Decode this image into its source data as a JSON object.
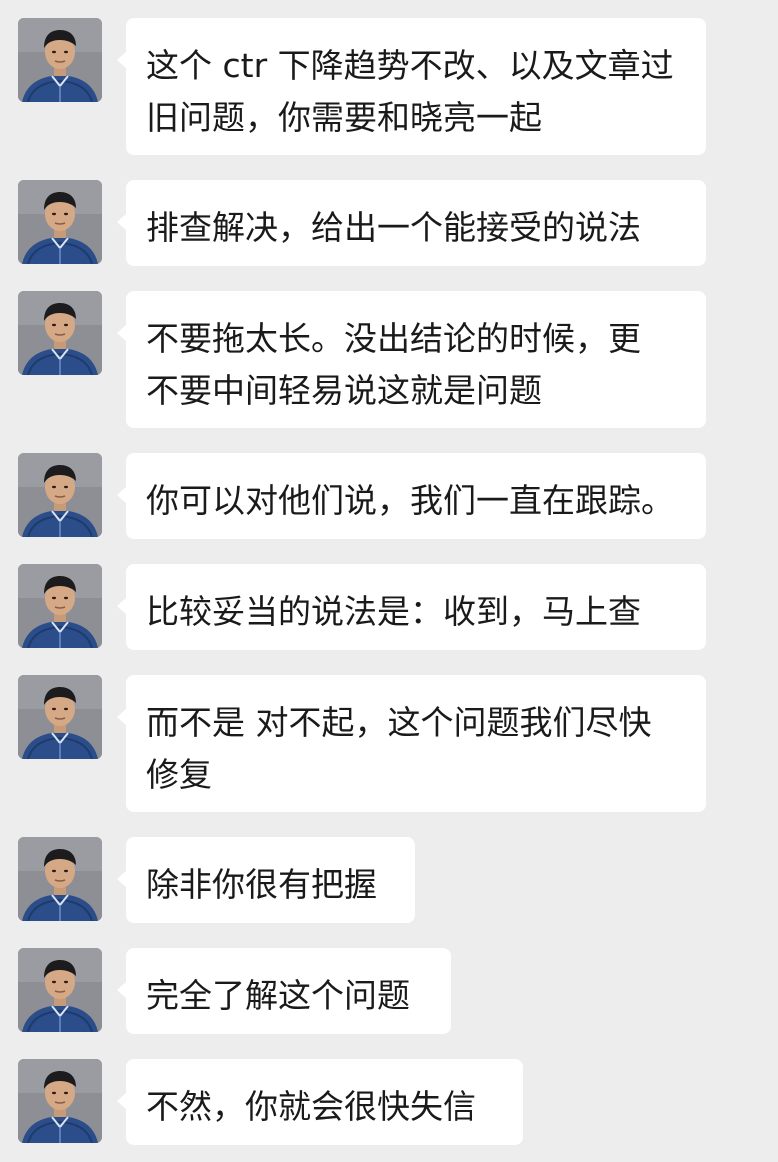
{
  "conversation": {
    "messages": [
      {
        "sender_avatar": "avatar-man-blue-sweater",
        "text": "这个 ctr 下降趋势不改、以及文章过\n旧问题，你需要和晓亮一起"
      },
      {
        "sender_avatar": "avatar-man-blue-sweater",
        "text": "排查解决，给出一个能接受的说法"
      },
      {
        "sender_avatar": "avatar-man-blue-sweater",
        "text": "不要拖太长。没出结论的时候，更\n不要中间轻易说这就是问题"
      },
      {
        "sender_avatar": "avatar-man-blue-sweater",
        "text": "你可以对他们说，我们一直在跟踪。"
      },
      {
        "sender_avatar": "avatar-man-blue-sweater",
        "text": "比较妥当的说法是：收到，马上查"
      },
      {
        "sender_avatar": "avatar-man-blue-sweater",
        "text": "而不是 对不起，这个问题我们尽快\n修复"
      },
      {
        "sender_avatar": "avatar-man-blue-sweater",
        "text": "除非你很有把握"
      },
      {
        "sender_avatar": "avatar-man-blue-sweater",
        "text": "完全了解这个问题"
      },
      {
        "sender_avatar": "avatar-man-blue-sweater",
        "text": "不然，你就会很快失信"
      }
    ]
  },
  "colors": {
    "background": "#ededed",
    "bubble": "#ffffff",
    "text": "#1a1a1a"
  }
}
